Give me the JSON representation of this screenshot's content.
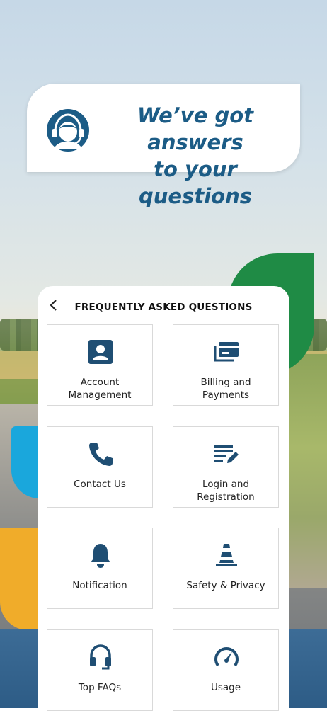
{
  "hero": {
    "title_line1": "We’ve got answers",
    "title_line2": "to your questions"
  },
  "header": {
    "title": "FREQUENTLY ASKED QUESTIONS"
  },
  "colors": {
    "brand_blue": "#1c5c86",
    "icon_blue": "#1f4e73",
    "green": "#1f8b45",
    "cyan": "#1aa7dc",
    "orange": "#f0ac2a"
  },
  "tiles": [
    {
      "line1": "Account",
      "line2": "Management",
      "icon": "account-card-icon"
    },
    {
      "line1": "Billing and",
      "line2": "Payments",
      "icon": "wallet-icon"
    },
    {
      "line1": "Contact Us",
      "line2": "",
      "icon": "phone-icon"
    },
    {
      "line1": "Login and",
      "line2": "Registration",
      "icon": "edit-list-icon"
    },
    {
      "line1": "Notification",
      "line2": "",
      "icon": "bell-icon"
    },
    {
      "line1": "Safety & Privacy",
      "line2": "",
      "icon": "traffic-cone-icon"
    },
    {
      "line1": "Top FAQs",
      "line2": "",
      "icon": "headset-icon"
    },
    {
      "line1": "Usage",
      "line2": "",
      "icon": "speedometer-icon"
    }
  ]
}
